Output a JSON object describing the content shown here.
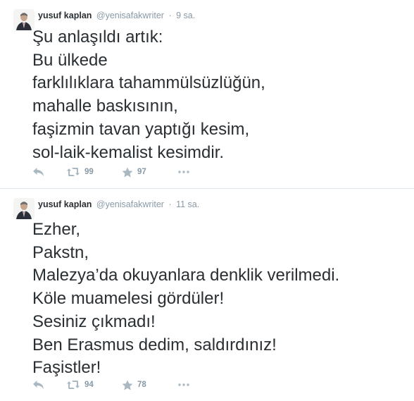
{
  "tweets": [
    {
      "author_name": "yusuf kaplan",
      "author_handle": "@yenisafakwriter",
      "separator": "·",
      "time": "9 sa.",
      "lines": [
        "Şu anlaşıldı artık:",
        "Bu ülkede",
        "farklılıklara tahammülsüzlüğün,",
        "mahalle baskısının,",
        "faşizmin tavan yaptığı kesim,",
        "sol-laik-kemalist kesimdir."
      ],
      "retweets": "99",
      "favorites": "97"
    },
    {
      "author_name": "yusuf kaplan",
      "author_handle": "@yenisafakwriter",
      "separator": "·",
      "time": "11 sa.",
      "lines": [
        "Ezher,",
        "Pakstn,",
        "Malezya’da okuyanlara denklik verilmedi.",
        "Köle muamelesi gördüler!",
        "Sesiniz çıkmadı!",
        "Ben Erasmus dedim, saldırdınız!",
        "Faşistler!"
      ],
      "retweets": "94",
      "favorites": "78"
    }
  ],
  "icons": {
    "reply": "reply-icon",
    "retweet": "retweet-icon",
    "favorite": "star-icon",
    "more": "more-dots-icon"
  },
  "colors": {
    "text": "#292f33",
    "meta": "#8899a6",
    "action_icon": "#aab8c2",
    "divider": "#e1e8ed"
  }
}
